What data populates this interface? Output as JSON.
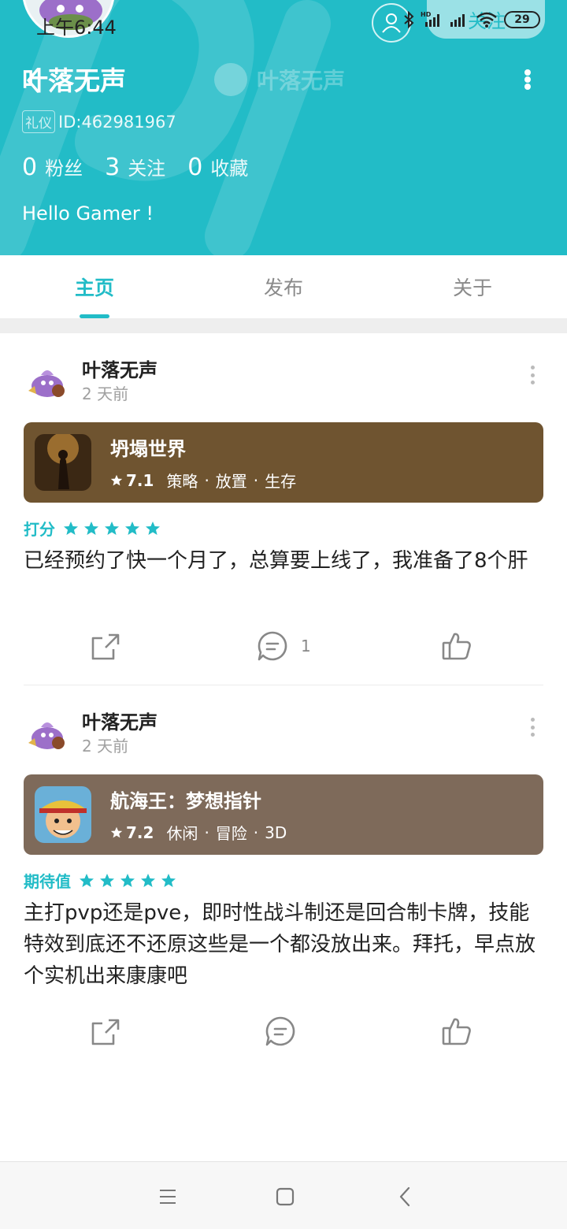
{
  "status_bar": {
    "time": "上午6:44",
    "battery": "29",
    "hd_label": "HD"
  },
  "header": {
    "follow_label": "关注",
    "user_name": "叶落无声",
    "ghost_name": "叶落无声",
    "badge": "礼仪",
    "user_id": "ID:462981967",
    "stats": [
      {
        "count": "0",
        "label": "粉丝"
      },
      {
        "count": "3",
        "label": "关注"
      },
      {
        "count": "0",
        "label": "收藏"
      }
    ],
    "bio": "Hello Gamer !",
    "accent_color": "#22bcc7"
  },
  "tabs": [
    {
      "label": "主页",
      "active": true
    },
    {
      "label": "发布",
      "active": false
    },
    {
      "label": "关于",
      "active": false
    }
  ],
  "posts": [
    {
      "author": "叶落无声",
      "time": "2 天前",
      "game": {
        "title": "坍塌世界",
        "score": "7.1",
        "tags": [
          "策略",
          "放置",
          "生存"
        ],
        "card_color": "#6f5430"
      },
      "rating_label": "打分",
      "stars": 5,
      "text": "已经预约了快一个月了，总算要上线了，我准备了8个肝",
      "comment_count": "1"
    },
    {
      "author": "叶落无声",
      "time": "2 天前",
      "game": {
        "title": "航海王：梦想指针",
        "score": "7.2",
        "tags": [
          "休闲",
          "冒险",
          "3D"
        ],
        "card_color": "#7e6a5a"
      },
      "rating_label": "期待值",
      "stars": 5,
      "text": "主打pvp还是pve，即时性战斗制还是回合制卡牌，技能特效到底还不还原这些是一个都没放出来。拜托，早点放个实机出来康康吧",
      "comment_count": ""
    }
  ],
  "icons": {
    "share": "share-icon",
    "comment": "comment-icon",
    "like": "thumbs-up-icon",
    "menu": "menu-icon",
    "home": "home-square-icon",
    "back": "back-icon"
  }
}
